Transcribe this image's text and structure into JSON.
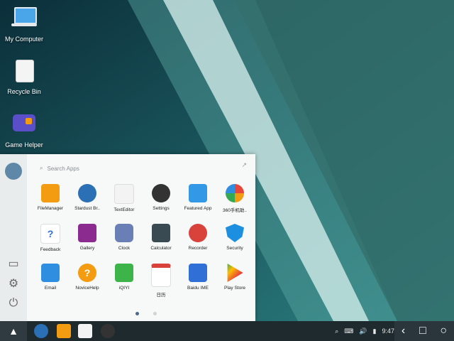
{
  "desktop": {
    "icons": [
      {
        "label": "My Computer",
        "icon": "laptop-icon"
      },
      {
        "label": "Recycle Bin",
        "icon": "trash-icon"
      },
      {
        "label": "Game Helper",
        "icon": "gamepad-icon"
      }
    ]
  },
  "start_menu": {
    "search_placeholder": "Search Apps",
    "apps": [
      {
        "label": "FileManager",
        "icon": "folder-icon",
        "color": "#f39c12"
      },
      {
        "label": "Stardust Br..",
        "icon": "globe-icon",
        "color": "#2b6fb5"
      },
      {
        "label": "TextEditor",
        "icon": "edit-icon",
        "color": "#f3f3f3"
      },
      {
        "label": "Settings",
        "icon": "gear-icon",
        "color": "#333333"
      },
      {
        "label": "Featured App",
        "icon": "store-icon",
        "color": "#3399e6"
      },
      {
        "label": "360手机助..",
        "icon": "assistant-icon",
        "color": "#e6463c"
      },
      {
        "label": "Feedback",
        "icon": "question-icon",
        "color": "#ffffff"
      },
      {
        "label": "Gallery",
        "icon": "gallery-icon",
        "color": "#8b2a8f"
      },
      {
        "label": "Clock",
        "icon": "clock-icon",
        "color": "#6a7fb6"
      },
      {
        "label": "Calculator",
        "icon": "calculator-icon",
        "color": "#3a4a52"
      },
      {
        "label": "Recorder",
        "icon": "recorder-icon",
        "color": "#d9413b"
      },
      {
        "label": "Security",
        "icon": "shield-icon",
        "color": "#1d8fe0"
      },
      {
        "label": "Email",
        "icon": "mail-icon",
        "color": "#2f8ee0"
      },
      {
        "label": "NoviceHelp",
        "icon": "help-icon",
        "color": "#f39c12"
      },
      {
        "label": "iQIYI",
        "icon": "iqiyi-icon",
        "color": "#3cb44a"
      },
      {
        "label": "日历",
        "icon": "calendar-icon",
        "color": "#d9413b"
      },
      {
        "label": "Baidu IME",
        "icon": "baidu-icon",
        "color": "#2f6fd6"
      },
      {
        "label": "Play Store",
        "icon": "play-icon",
        "color": "#34a853"
      }
    ],
    "pages": [
      {
        "active": true
      },
      {
        "active": false
      }
    ]
  },
  "taskbar": {
    "apps": [
      "browser-icon",
      "files-icon",
      "editor-icon",
      "settings-icon"
    ],
    "time": "9:47"
  }
}
